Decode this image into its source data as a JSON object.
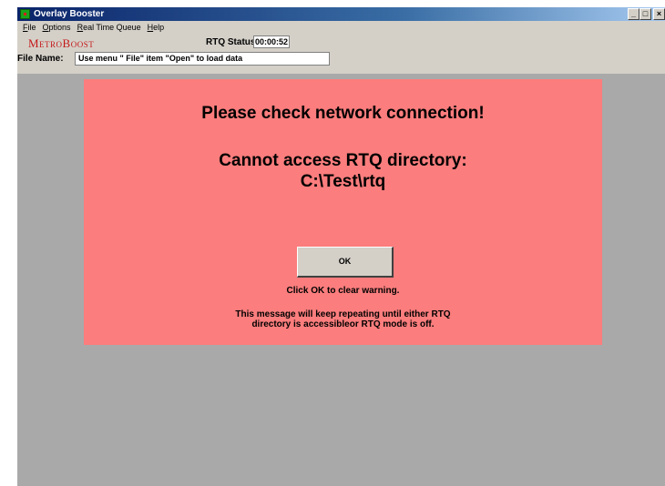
{
  "window": {
    "title": "Overlay Booster",
    "controls": {
      "minimize": "_",
      "maximize": "□",
      "close": "×"
    }
  },
  "menu": {
    "items": [
      {
        "key": "F",
        "rest": "ile"
      },
      {
        "key": "O",
        "rest": "ptions"
      },
      {
        "key": "R",
        "rest": "eal Time Queue"
      },
      {
        "key": "H",
        "rest": "elp"
      }
    ]
  },
  "header": {
    "brand": "MetroBoost",
    "rtq_label": "RTQ Status:",
    "rtq_value": "00:00:52",
    "file_label": "File Name:",
    "file_value": "Use menu \" File\" item \"Open\" to load data"
  },
  "warning": {
    "line1": "Please check network connection!",
    "line2": "Cannot access RTQ directory:",
    "line3": "C:\\Test\\rtq",
    "ok_label": "OK",
    "click_hint": "Click OK to clear warning.",
    "repeat_line1": "This message will keep repeating until either RTQ",
    "repeat_line2": "directory is accessibleor RTQ mode is off."
  },
  "colors": {
    "panel": "#fb7d7d",
    "background": "#a9a9a9",
    "brand": "#c41818",
    "chrome": "#d4d0c8"
  }
}
